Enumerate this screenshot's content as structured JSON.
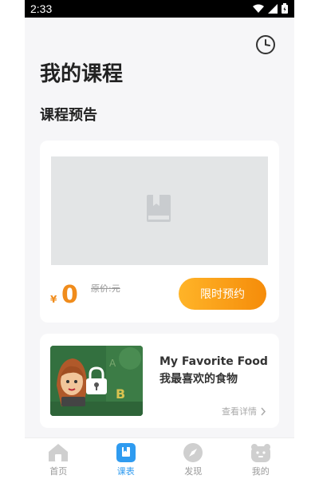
{
  "status": {
    "time": "2:33"
  },
  "page": {
    "title": "我的课程",
    "section_title": "课程预告"
  },
  "preview_card": {
    "price_symbol": "¥",
    "price": "0",
    "original_price": "原价:元",
    "reserve_label": "限时预约"
  },
  "course_card": {
    "title": "My Favorite Food 我最喜欢的食物",
    "detail_label": "查看详情"
  },
  "tabs": [
    {
      "label": "首页",
      "icon": "home-icon"
    },
    {
      "label": "课表",
      "icon": "schedule-icon"
    },
    {
      "label": "发现",
      "icon": "compass-icon"
    },
    {
      "label": "我的",
      "icon": "profile-icon"
    }
  ],
  "colors": {
    "accent_orange": "#f58c0a",
    "active_tab": "#2f9bf0"
  }
}
